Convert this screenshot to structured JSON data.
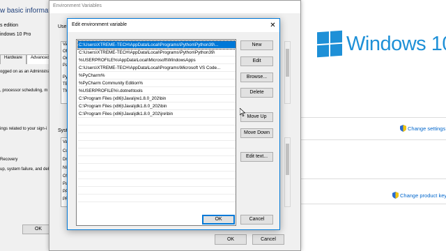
{
  "background": {
    "heading": "w basic informatio",
    "edition_label": "s edition",
    "edition_value": "indows 10 Pro",
    "tabs": [
      "Hardware",
      "Advanced"
    ],
    "lines": [
      "ogged on as an Administra",
      ", processor scheduling, m",
      "ings related to your sign-i",
      "Recovery",
      "up, system failure, and deb"
    ],
    "ok_label": "OK",
    "logo_text": "Windows 10",
    "change_settings": "Change settings",
    "change_product_key": "Change product key"
  },
  "env_dialog": {
    "title": "Environment Variables",
    "user_label_frag": "User",
    "system_label_frag": "Syst",
    "user_frags": [
      "Va",
      "Of",
      "On",
      "Pa",
      "Py",
      "TE",
      "TM"
    ],
    "system_frags": [
      "Va",
      "Co",
      "Dr",
      "NU",
      "OS",
      "Pa",
      "PA",
      "PR"
    ],
    "ok_label": "OK",
    "cancel_label": "Cancel"
  },
  "edit_dialog": {
    "title": "Edit environment variable",
    "close_glyph": "✕",
    "paths": [
      "C:\\Users\\XTREME-TECH\\AppData\\Local\\Programs\\Python\\Python39\\...",
      "C:\\Users\\XTREME-TECH\\AppData\\Local\\Programs\\Python\\Python39\\",
      "%USERPROFILE%\\AppData\\Local\\Microsoft\\WindowsApps",
      "C:\\Users\\XTREME-TECH\\AppData\\Local\\Programs\\Microsoft VS Code...",
      "%PyCharm%",
      "%PyCharm Community Edition%",
      "%USERPROFILE%\\.dotnet\\tools",
      "C:\\Program Files (x86)\\Java\\jre1.8.0_202\\bin",
      "C:\\Program Files (x86)\\Java\\jdk1.8.0_202\\bin",
      "C:\\Program Files (x86)\\Java\\jdk1.8.0_202\\jre\\bin"
    ],
    "selected_index": 0,
    "buttons": {
      "new": "New",
      "edit": "Edit",
      "browse": "Browse...",
      "delete": "Delete",
      "move_up": "Move Up",
      "move_down": "Move Down",
      "edit_text": "Edit text...",
      "ok": "OK",
      "cancel": "Cancel"
    }
  },
  "colors": {
    "accent": "#0078d7",
    "windows_blue": "#1e90d7",
    "link": "#0066cc"
  }
}
